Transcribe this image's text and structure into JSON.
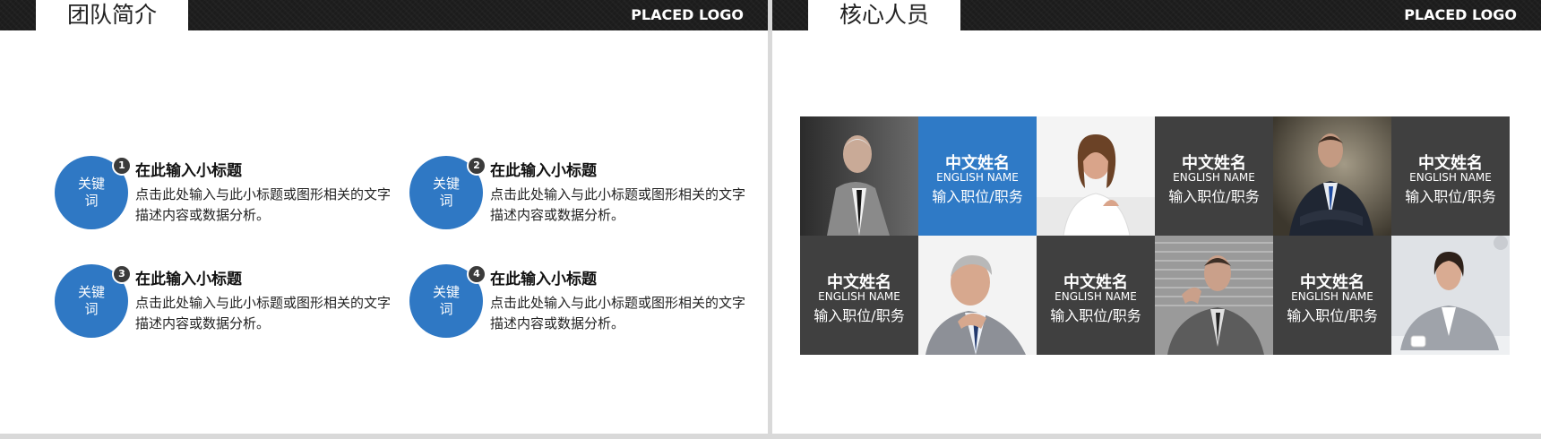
{
  "left_slide": {
    "title": "团队简介",
    "logo": "PLACED LOGO",
    "items": [
      {
        "number": "1",
        "keyword": "关键词",
        "title": "在此输入小标题",
        "desc": "点击此处输入与此小标题或图形相关的文字描述内容或数据分析。"
      },
      {
        "number": "2",
        "keyword": "关键词",
        "title": "在此输入小标题",
        "desc": "点击此处输入与此小标题或图形相关的文字描述内容或数据分析。"
      },
      {
        "number": "3",
        "keyword": "关键词",
        "title": "在此输入小标题",
        "desc": "点击此处输入与此小标题或图形相关的文字描述内容或数据分析。"
      },
      {
        "number": "4",
        "keyword": "关键词",
        "title": "在此输入小标题",
        "desc": "点击此处输入与此小标题或图形相关的文字描述内容或数据分析。"
      }
    ]
  },
  "right_slide": {
    "title": "核心人员",
    "logo": "PLACED LOGO",
    "cards": [
      {
        "name_zh": "中文姓名",
        "name_en": "ENGLISH NAME",
        "position": "输入职位/职务"
      },
      {
        "name_zh": "中文姓名",
        "name_en": "ENGLISH NAME",
        "position": "输入职位/职务"
      },
      {
        "name_zh": "中文姓名",
        "name_en": "ENGLISH NAME",
        "position": "输入职位/职务"
      },
      {
        "name_zh": "中文姓名",
        "name_en": "ENGLISH NAME",
        "position": "输入职位/职务"
      },
      {
        "name_zh": "中文姓名",
        "name_en": "ENGLISH NAME",
        "position": "输入职位/职务"
      },
      {
        "name_zh": "中文姓名",
        "name_en": "ENGLISH NAME",
        "position": "输入职位/职务"
      }
    ]
  },
  "colors": {
    "accent_blue": "#2f78c4",
    "dark_tile": "#404040",
    "header_bar": "#1c1c1c"
  }
}
